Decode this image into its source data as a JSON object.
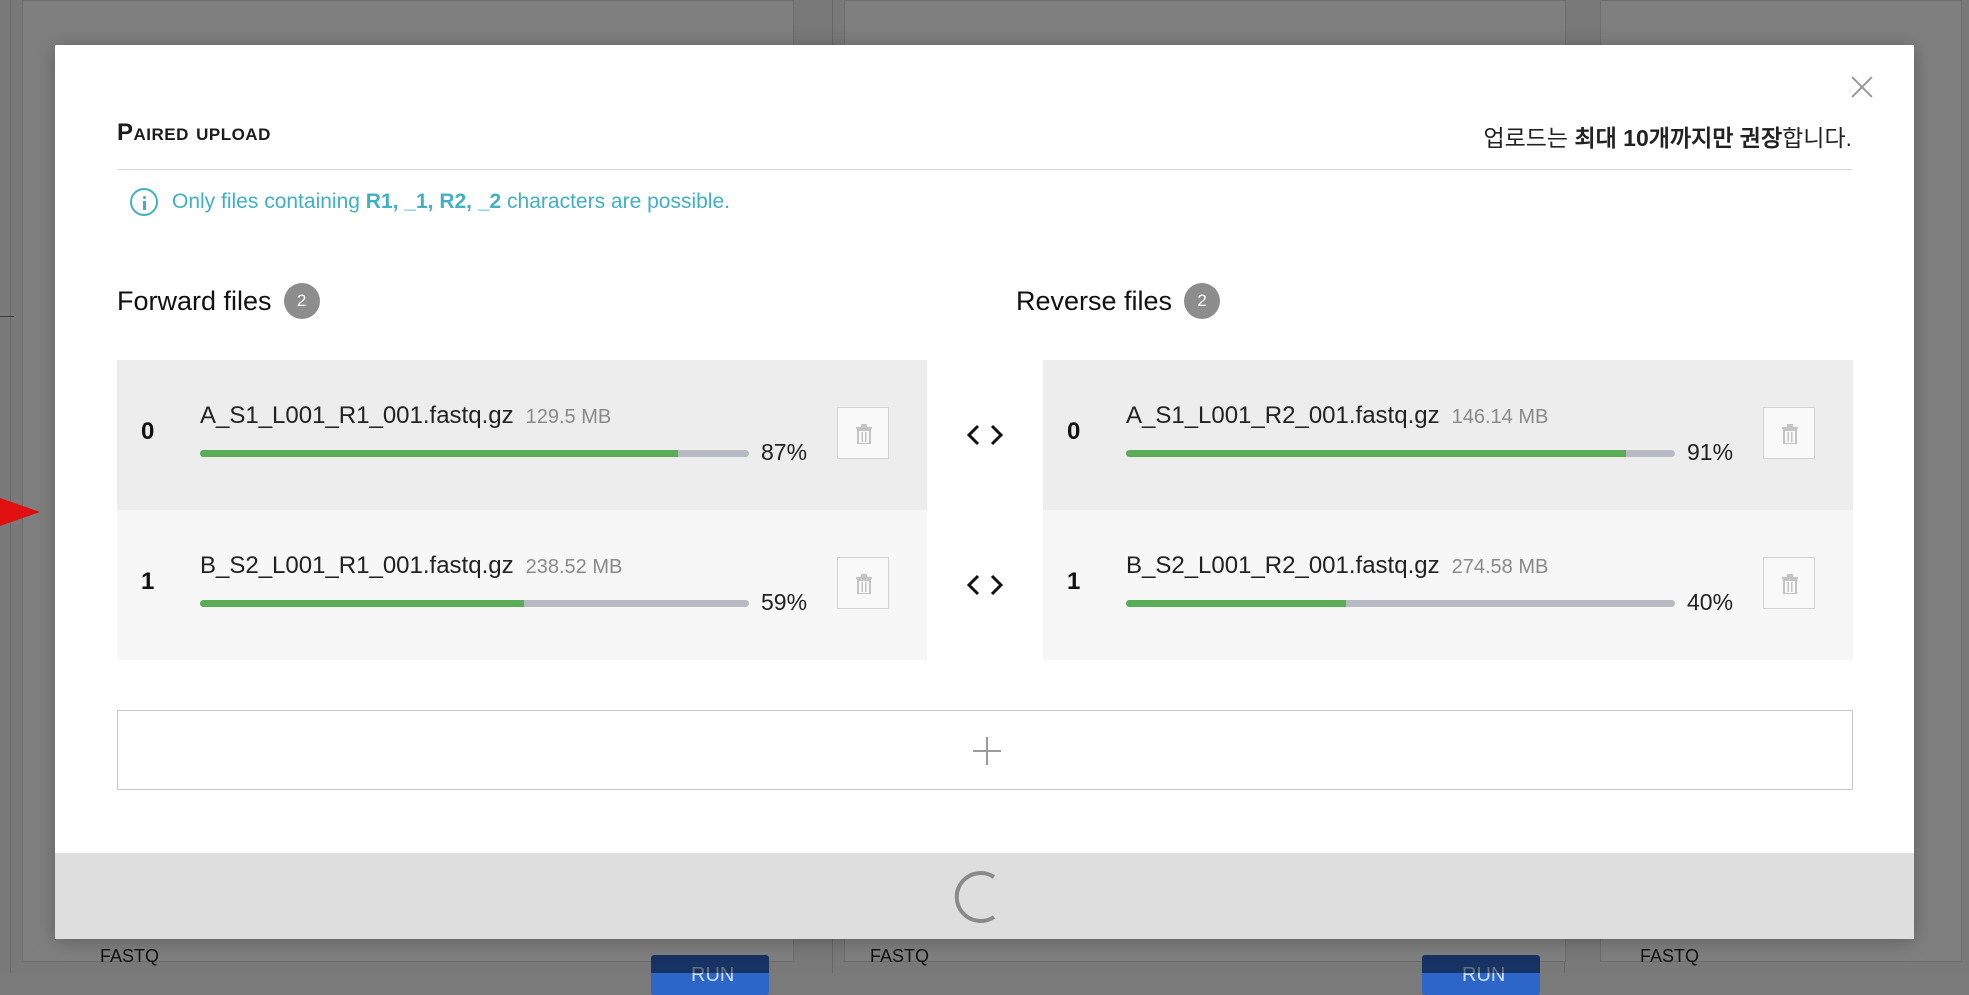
{
  "background": {
    "card_label": "FASTQ",
    "run_label": "RUN"
  },
  "modal": {
    "title": "PAIRED UPLOAD",
    "upload_limit": {
      "prefix": "업로드는 ",
      "bold": "최대 10개까지만 권장",
      "suffix": "합니다."
    },
    "info": {
      "before": "Only files containing ",
      "chars": "R1, _1, R2, _2",
      "after": " characters are possible."
    },
    "forward": {
      "title": "Forward files",
      "count": "2",
      "files": [
        {
          "index": "0",
          "name": "A_S1_L001_R1_001.fastq.gz",
          "size": "129.5 MB",
          "percent_label": "87%",
          "progress": 0.87
        },
        {
          "index": "1",
          "name": "B_S2_L001_R1_001.fastq.gz",
          "size": "238.52 MB",
          "percent_label": "59%",
          "progress": 0.59
        }
      ]
    },
    "reverse": {
      "title": "Reverse files",
      "count": "2",
      "files": [
        {
          "index": "0",
          "name": "A_S1_L001_R2_001.fastq.gz",
          "size": "146.14 MB",
          "percent_label": "91%",
          "progress": 0.91
        },
        {
          "index": "1",
          "name": "B_S2_L001_R2_001.fastq.gz",
          "size": "274.58 MB",
          "percent_label": "40%",
          "progress": 0.4
        }
      ]
    },
    "icons": {
      "close": "close-icon",
      "info": "info-icon",
      "delete": "trash-icon",
      "pair": "swap-icon",
      "add": "plus-icon",
      "loading": "spinner-icon"
    },
    "colors": {
      "accent": "#41b0c3",
      "progress": "#5aad57",
      "badge": "#8d8d8d"
    }
  }
}
